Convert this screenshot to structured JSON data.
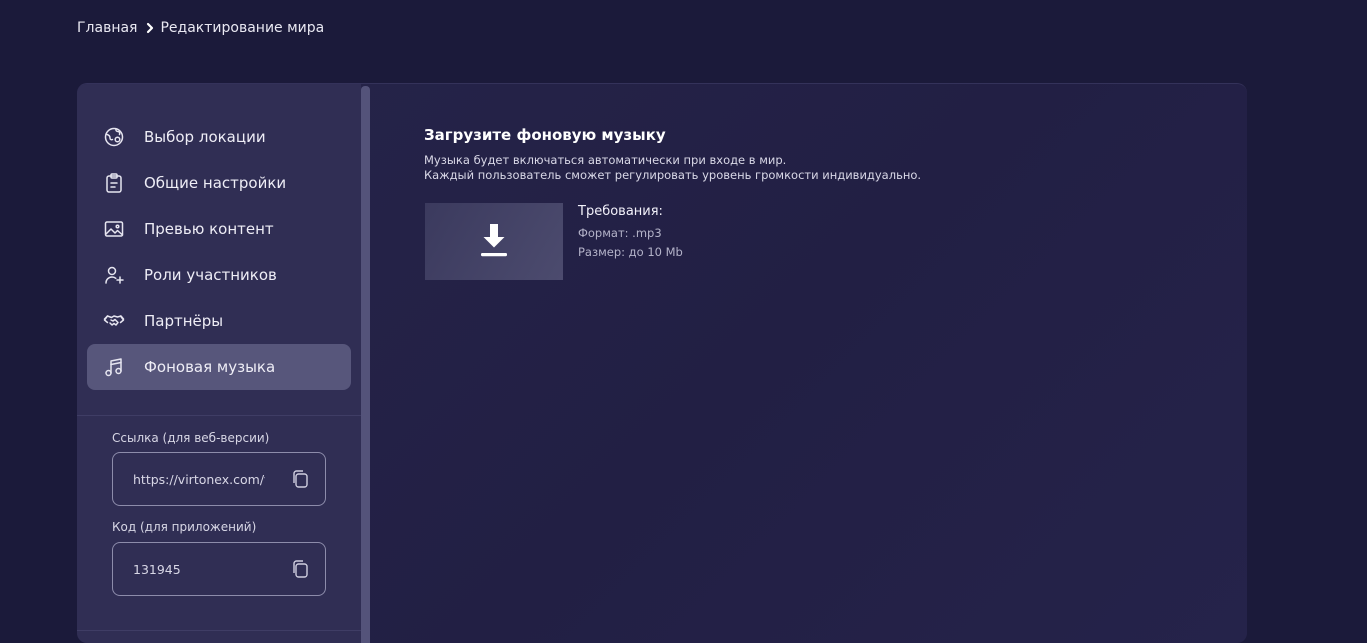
{
  "breadcrumb": {
    "home": "Главная",
    "current": "Редактирование мира"
  },
  "sidebar": {
    "items": [
      {
        "label": "Выбор локации",
        "icon": "location-globe-icon",
        "active": false
      },
      {
        "label": "Общие настройки",
        "icon": "clipboard-icon",
        "active": false
      },
      {
        "label": "Превью контент",
        "icon": "image-icon",
        "active": false
      },
      {
        "label": "Роли участников",
        "icon": "user-add-icon",
        "active": false
      },
      {
        "label": "Партнёры",
        "icon": "handshake-icon",
        "active": false
      },
      {
        "label": "Фоновая музыка",
        "icon": "music-note-icon",
        "active": true
      }
    ],
    "link_label": "Ссылка (для веб-версии)",
    "link_value": "https://virtonex.com/v",
    "code_label": "Код (для приложений)",
    "code_value": "131945"
  },
  "main": {
    "title": "Загрузите фоновую музыку",
    "description_line1": "Музыка будет включаться автоматически при входе в мир.",
    "description_line2": "Каждый пользователь сможет регулировать уровень громкости индивидуально.",
    "upload_icon": "download-icon",
    "requirements_title": "Требования:",
    "requirement_format": "Формат: .mp3",
    "requirement_size": "Размер: до 10 Mb"
  },
  "colors": {
    "background": "#1b1a3a",
    "sidebar": "#302e54",
    "active_item": "#57567b"
  }
}
